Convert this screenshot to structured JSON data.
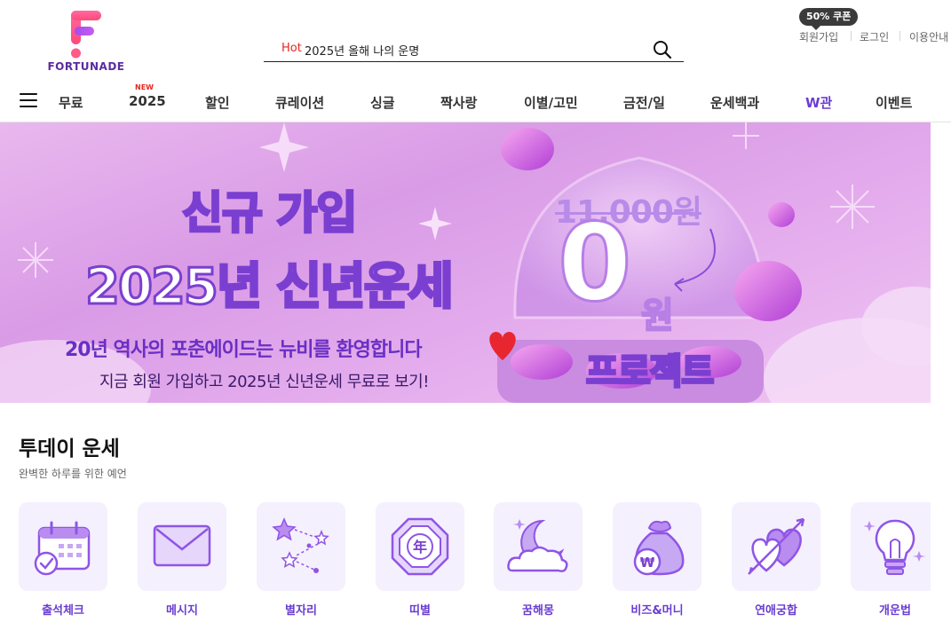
{
  "header": {
    "logo_text": "FORTUNADE",
    "search": {
      "hot_label": "Hot",
      "text": "2025년 올해 나의 운명"
    },
    "coupon_badge": "50% 쿠폰",
    "util_links": [
      "회원가입",
      "로그인",
      "이용안내"
    ]
  },
  "nav": {
    "new_badge": "NEW",
    "items": [
      "무료",
      "2025",
      "할인",
      "큐레이션",
      "싱글",
      "짝사랑",
      "이별/고민",
      "금전/일",
      "운세백과",
      "W관",
      "이벤트"
    ]
  },
  "banner": {
    "title_line1": "신규 가입",
    "title_line2": "2025년 신년운세",
    "subtitle1": "20년 역사의 포춘에이드는 뉴비를 환영합니다",
    "subtitle2": "지금 회원 가입하고 2025년 신년운세 무료로 보기!",
    "old_price": "11,000원",
    "zero": "0",
    "won": "원",
    "project": "프로젝트"
  },
  "today": {
    "title": "투데이 운세",
    "subtitle": "완벽한 하루를 위한 예언",
    "items": [
      {
        "label": "출석체크",
        "icon": "calendar-check-icon"
      },
      {
        "label": "메시지",
        "icon": "envelope-icon"
      },
      {
        "label": "별자리",
        "icon": "constellation-icon"
      },
      {
        "label": "띠별",
        "icon": "zodiac-year-icon",
        "glyph": "年"
      },
      {
        "label": "꿈해몽",
        "icon": "moon-cloud-icon"
      },
      {
        "label": "비즈&머니",
        "icon": "money-bag-icon",
        "glyph": "₩"
      },
      {
        "label": "연애궁합",
        "icon": "hearts-arrow-icon"
      },
      {
        "label": "개운법",
        "icon": "lightbulb-icon"
      }
    ]
  },
  "colors": {
    "accent": "#6a3dd1",
    "hot": "#e8261f",
    "tile_bg": "#f5f0fd",
    "banner_bg": "#dfa6ea"
  }
}
